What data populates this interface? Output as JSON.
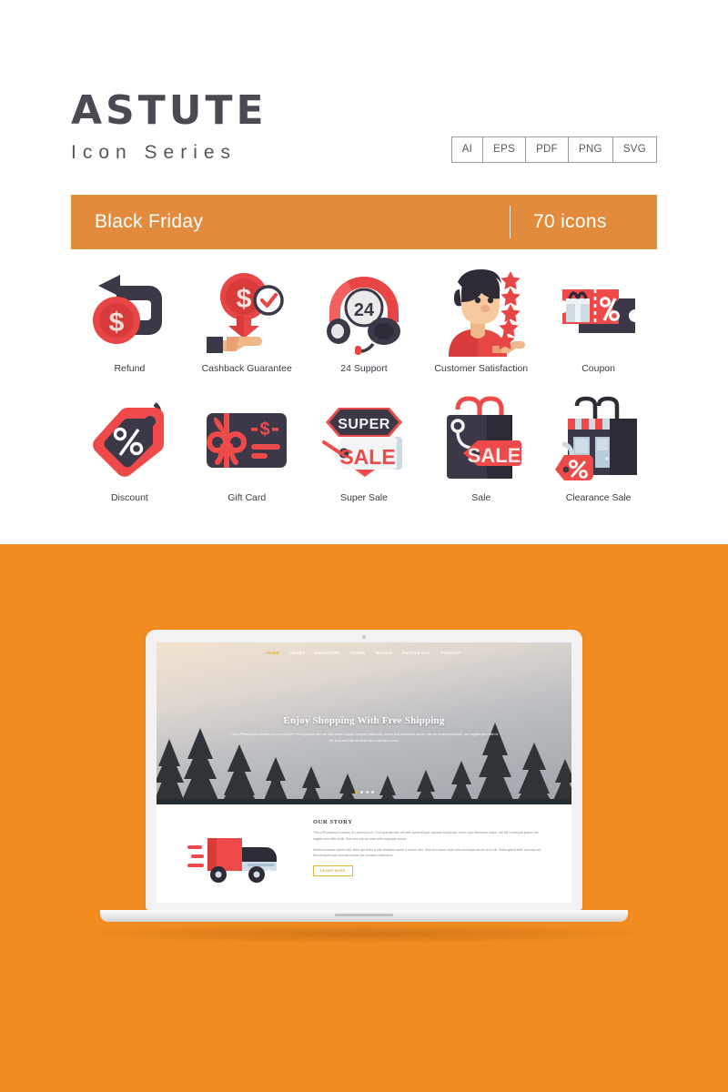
{
  "brand": {
    "title": "ASTUTE",
    "subtitle": "Icon Series"
  },
  "formats": [
    "AI",
    "EPS",
    "PDF",
    "PNG",
    "SVG"
  ],
  "titlebar": {
    "name": "Black Friday",
    "count": "70 icons"
  },
  "colors": {
    "banner_orange": "#E28B3D",
    "panel_orange": "#F28C20",
    "icon_red": "#EF4A4A",
    "icon_red_dark": "#D93A3A",
    "icon_dark": "#393642",
    "text_dark": "#3B3B42",
    "accent_yellow": "#E8B53C"
  },
  "icons": [
    {
      "name": "refund",
      "label": "Refund"
    },
    {
      "name": "cashback-guarantee",
      "label": "Cashback Guarantee"
    },
    {
      "name": "24-support",
      "label": "24 Support"
    },
    {
      "name": "customer-satisfaction",
      "label": "Customer\nSatisfaction"
    },
    {
      "name": "coupon",
      "label": "Coupon"
    },
    {
      "name": "discount",
      "label": "Discount"
    },
    {
      "name": "gift-card",
      "label": "Gift Card"
    },
    {
      "name": "super-sale",
      "label": "Super Sale"
    },
    {
      "name": "sale",
      "label": "Sale"
    },
    {
      "name": "clearance-sale",
      "label": "Clearance Sale"
    }
  ],
  "icon_text": {
    "support_number": "24",
    "super": "SUPER",
    "sale": "SALE",
    "sale_bag": "SALE",
    "percent": "%",
    "dollar": "$"
  },
  "mockup": {
    "nav": [
      "HOME",
      "ABOUT",
      "EXPERTISE",
      "TEAMS",
      "WORKS",
      "PEOPLE SAY",
      "CONTACT"
    ],
    "nav_active": "HOME",
    "hero_title": "Enjoy Shopping With Free Shipping",
    "hero_body": "This is Photoshop's version of Lorem Ipsum. Proin gravida nibh vel velit auctor aliquet. Aenean sollicitudin, lorem quis bibendum auctor, nisi elit consequat ipsum, nec sagittis sem nibh id elit. Duis sed odio sit amet nibh vulputate cursus.",
    "story_heading": "OUR STORY",
    "story_p1": "This is Photoshop's version of Lorem Ipsum. Proin gravida nibh vel velit auctor aliquet. Aenean sollicitudin, lorem quis bibendum auctor, nisi elit consequat ipsum, nec sagittis sem nibh id elit. Duis sed odio sit amet nibh vulputate cursus.",
    "story_p2": "Morbi accumsan ipsum velit. Nam nec tellus a odio tincidunt auctor a ornare odio. Sed non mauris vitae erat consequat auctor eu in elit. Class aptent taciti sociosqu ad litora torquent per conubia nostra, per inceptos himenaeos.",
    "learn_more": "LEARN MORE"
  }
}
